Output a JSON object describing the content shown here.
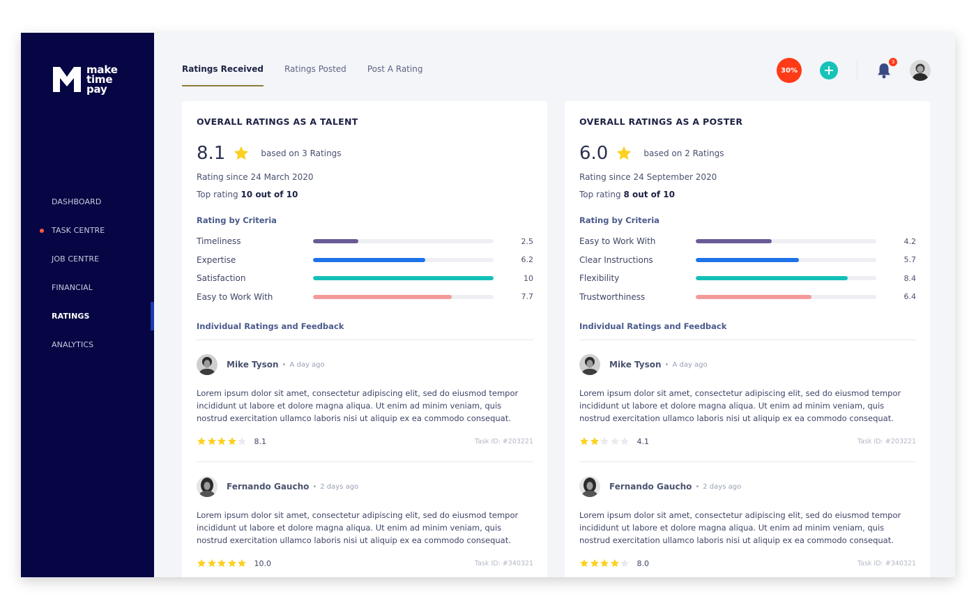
{
  "brand": {
    "logo_lines": [
      "make",
      "time",
      "pay"
    ]
  },
  "nav": {
    "items": [
      {
        "label": "DASHBOARD",
        "dot": false,
        "active": false
      },
      {
        "label": "TASK CENTRE",
        "dot": true,
        "active": false
      },
      {
        "label": "JOB CENTRE",
        "dot": false,
        "active": false
      },
      {
        "label": "FINANCIAL",
        "dot": false,
        "active": false
      },
      {
        "label": "RATINGS",
        "dot": false,
        "active": true
      },
      {
        "label": "ANALYTICS",
        "dot": false,
        "active": false
      }
    ]
  },
  "header": {
    "tabs": [
      {
        "label": "Ratings Received",
        "active": true
      },
      {
        "label": "Ratings Posted",
        "active": false
      },
      {
        "label": "Post A Rating",
        "active": false
      }
    ],
    "discount_badge": "30%",
    "add_icon": "plus-icon",
    "notification_count": "3",
    "bell_icon": "bell-icon"
  },
  "colors": {
    "sidebar_bg": "#060644",
    "accent_orange": "#ff3a16",
    "accent_teal": "#17c3b9",
    "star_yellow": "#fcd120",
    "bar_colors": [
      "#6a5a96",
      "#1d72e8",
      "#13c0b8",
      "#f59a9a"
    ]
  },
  "talent": {
    "title": "OVERALL RATINGS AS A TALENT",
    "score": "8.1",
    "based_on": "based on 3 Ratings",
    "since": "Rating since 24 March 2020",
    "top_prefix": "Top rating ",
    "top_value": "10 out of 10",
    "criteria_title": "Rating by Criteria",
    "criteria": [
      {
        "name": "Timeliness",
        "value": 2.5,
        "label": "2.5"
      },
      {
        "name": "Expertise",
        "value": 6.2,
        "label": "6.2"
      },
      {
        "name": "Satisfaction",
        "value": 10,
        "label": "10"
      },
      {
        "name": "Easy to Work With",
        "value": 7.7,
        "label": "7.7"
      }
    ],
    "individual_title": "Individual Ratings and Feedback",
    "reviews": [
      {
        "name": "Mike Tyson",
        "dot": "•",
        "time": "A day ago",
        "text": "Lorem ipsum dolor sit amet, consectetur adipiscing elit, sed do eiusmod tempor incididunt ut labore et dolore magna aliqua. Ut enim ad minim veniam, quis nostrud exercitation ullamco laboris nisi ut aliquip ex ea commodo consequat.",
        "stars": 4,
        "score": "8.1",
        "task": "Task ID: #203221"
      },
      {
        "name": "Fernando Gaucho",
        "dot": "•",
        "time": "2 days ago",
        "text": "Lorem ipsum dolor sit amet, consectetur adipiscing elit, sed do eiusmod tempor incididunt ut labore et dolore magna aliqua. Ut enim ad minim veniam, quis nostrud exercitation ullamco laboris nisi ut aliquip ex ea commodo consequat.",
        "stars": 5,
        "score": "10.0",
        "task": "Task ID: #340321"
      }
    ]
  },
  "poster": {
    "title": "OVERALL RATINGS AS A POSTER",
    "score": "6.0",
    "based_on": "based on 2 Ratings",
    "since": "Rating since 24 September 2020",
    "top_prefix": "Top rating ",
    "top_value": "8 out of 10",
    "criteria_title": "Rating by Criteria",
    "criteria": [
      {
        "name": "Easy to Work With",
        "value": 4.2,
        "label": "4.2"
      },
      {
        "name": "Clear Instructions",
        "value": 5.7,
        "label": "5.7"
      },
      {
        "name": "Flexibility",
        "value": 8.4,
        "label": "8.4"
      },
      {
        "name": "Trustworthiness",
        "value": 6.4,
        "label": "6.4"
      }
    ],
    "individual_title": "Individual Ratings and Feedback",
    "reviews": [
      {
        "name": "Mike Tyson",
        "dot": "•",
        "time": "A day ago",
        "text": "Lorem ipsum dolor sit amet, consectetur adipiscing elit, sed do eiusmod tempor incididunt ut labore et dolore magna aliqua. Ut enim ad minim veniam, quis nostrud exercitation ullamco laboris nisi ut aliquip ex ea commodo consequat.",
        "stars": 2,
        "score": "4.1",
        "task": "Task ID: #203221"
      },
      {
        "name": "Fernando Gaucho",
        "dot": "•",
        "time": "2 days ago",
        "text": "Lorem ipsum dolor sit amet, consectetur adipiscing elit, sed do eiusmod tempor incididunt ut labore et dolore magna aliqua. Ut enim ad minim veniam, quis nostrud exercitation ullamco laboris nisi ut aliquip ex ea commodo consequat.",
        "stars": 4,
        "score": "8.0",
        "task": "Task ID: #340321"
      }
    ]
  }
}
